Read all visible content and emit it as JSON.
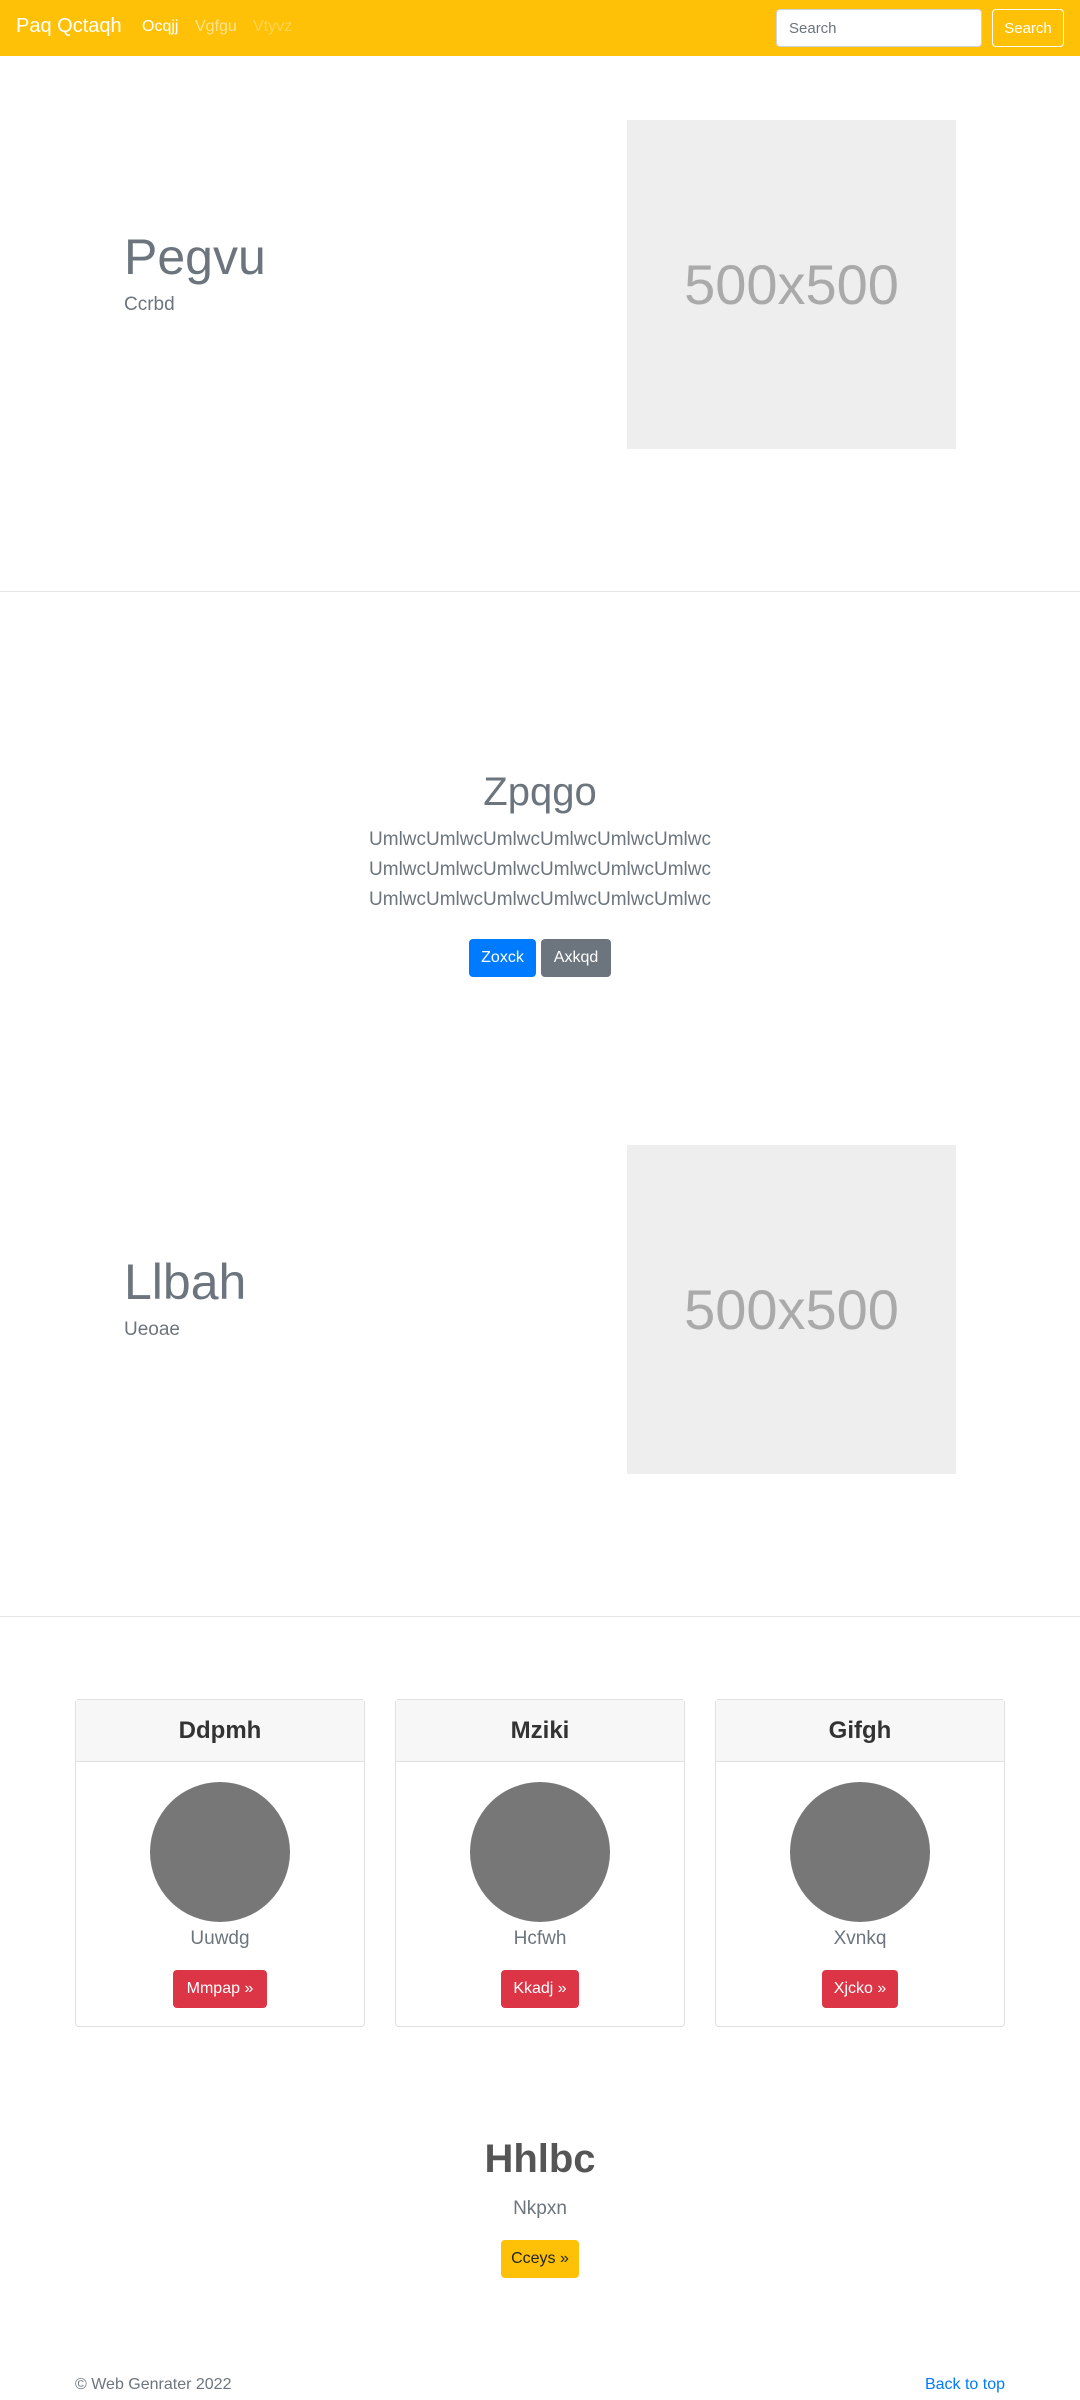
{
  "navbar": {
    "brand": "Paq Qctaqh",
    "links": [
      "Ocqjj",
      "Vgfgu",
      "Vtyvz"
    ],
    "search_placeholder": "Search",
    "search_button": "Search"
  },
  "feature1": {
    "title": "Pegvu",
    "subtitle": "Ccrbd",
    "image_text": "500x500"
  },
  "hero": {
    "title": "Zpqgo",
    "lines": [
      "UmlwcUmlwcUmlwcUmlwcUmlwcUmlwc",
      "UmlwcUmlwcUmlwcUmlwcUmlwcUmlwc",
      "UmlwcUmlwcUmlwcUmlwcUmlwcUmlwc"
    ],
    "primary_button": "Zoxck",
    "secondary_button": "Axkqd"
  },
  "feature2": {
    "title": "Llbah",
    "subtitle": "Ueoae",
    "image_text": "500x500"
  },
  "cards": [
    {
      "header": "Ddpmh",
      "name": "Uuwdg",
      "button": "Mmpap »"
    },
    {
      "header": "Mziki",
      "name": "Hcfwh",
      "button": "Kkadj »"
    },
    {
      "header": "Gifgh",
      "name": "Xvnkq",
      "button": "Xjcko »"
    }
  ],
  "cta": {
    "title": "Hhlbc",
    "subtitle": "Nkpxn",
    "button": "Cceys »"
  },
  "footer": {
    "copyright": "© Web Genrater 2022",
    "back_to_top": "Back to top"
  },
  "colors": {
    "navbar": "#ffc107",
    "primary": "#007bff",
    "secondary": "#6c757d",
    "danger": "#dc3545",
    "warning": "#ffc107"
  }
}
